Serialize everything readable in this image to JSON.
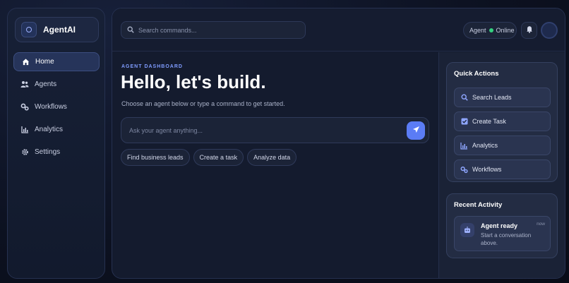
{
  "brand": {
    "name": "AgentAI",
    "logo_icon": "hexagon-icon"
  },
  "sidebar": {
    "items": [
      {
        "label": "Home",
        "icon": "home-icon",
        "active": true
      },
      {
        "label": "Agents",
        "icon": "users-icon",
        "active": false
      },
      {
        "label": "Workflows",
        "icon": "gears-icon",
        "active": false
      },
      {
        "label": "Analytics",
        "icon": "chart-icon",
        "active": false
      },
      {
        "label": "Settings",
        "icon": "gear-icon",
        "active": false
      }
    ]
  },
  "topbar": {
    "search_placeholder": "Search commands...",
    "agent_label": "Agent",
    "agent_status": "Online",
    "status_color": "#35d07f"
  },
  "hero": {
    "eyebrow": "AGENT DASHBOARD",
    "title": "Hello, let's build.",
    "subtitle": "Choose an agent below or type a command to get started."
  },
  "ask": {
    "placeholder": "Ask your agent anything...",
    "send_icon": "send-icon",
    "accent": "#5b7cf5"
  },
  "chips": [
    {
      "label": "Find business leads"
    },
    {
      "label": "Create a task"
    },
    {
      "label": "Analyze data"
    }
  ],
  "quick_actions": {
    "title": "Quick Actions",
    "items": [
      {
        "label": "Search Leads",
        "icon": "search-icon"
      },
      {
        "label": "Create Task",
        "icon": "checkbox-icon"
      },
      {
        "label": "Analytics",
        "icon": "chart-icon"
      },
      {
        "label": "Workflows",
        "icon": "gears-icon"
      }
    ]
  },
  "recent_activity": {
    "title": "Recent Activity",
    "items": [
      {
        "title": "Agent ready",
        "time": "now",
        "description": "Start a conversation above.",
        "icon": "robot-icon"
      }
    ]
  }
}
